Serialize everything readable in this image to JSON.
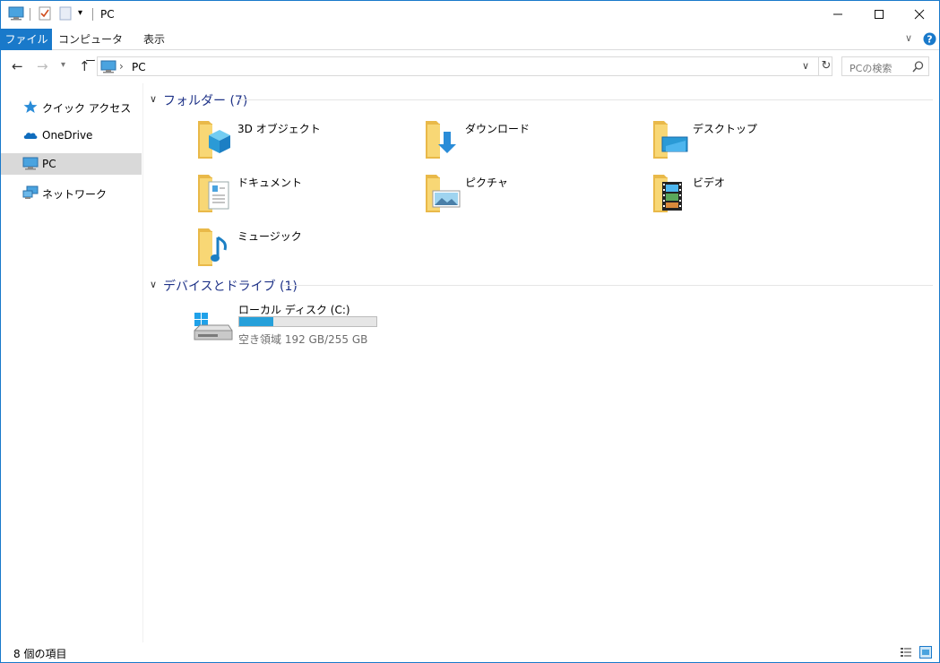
{
  "window": {
    "title": "PC"
  },
  "ribbon": {
    "tabs": [
      {
        "label": "ファイル"
      },
      {
        "label": "コンピューター"
      },
      {
        "label": "表示"
      }
    ]
  },
  "address": {
    "path": "PC",
    "search_placeholder": "PCの検索"
  },
  "sidebar": {
    "items": [
      {
        "label": "クイック アクセス",
        "icon": "star-icon"
      },
      {
        "label": "OneDrive",
        "icon": "cloud-icon"
      },
      {
        "label": "PC",
        "icon": "computer-icon",
        "selected": true
      },
      {
        "label": "ネットワーク",
        "icon": "network-icon"
      }
    ]
  },
  "content": {
    "folders_group": {
      "title": "フォルダー (7)"
    },
    "folders": [
      {
        "label": "3D オブジェクト",
        "icon": "3d-objects-folder-icon"
      },
      {
        "label": "ダウンロード",
        "icon": "downloads-folder-icon"
      },
      {
        "label": "デスクトップ",
        "icon": "desktop-folder-icon"
      },
      {
        "label": "ドキュメント",
        "icon": "documents-folder-icon"
      },
      {
        "label": "ピクチャ",
        "icon": "pictures-folder-icon"
      },
      {
        "label": "ビデオ",
        "icon": "videos-folder-icon"
      },
      {
        "label": "ミュージック",
        "icon": "music-folder-icon"
      }
    ],
    "drives_group": {
      "title": "デバイスとドライブ (1)"
    },
    "drives": [
      {
        "label": "ローカル ディスク (C:)",
        "free_text": "空き領域 192 GB/255 GB",
        "used_fraction": 0.247
      }
    ]
  },
  "status": {
    "item_count": "8 個の項目"
  },
  "colors": {
    "accent": "#1979ca",
    "group_title": "#1e3287",
    "usage_bar": "#26a0da",
    "folder": "#f8d775"
  }
}
